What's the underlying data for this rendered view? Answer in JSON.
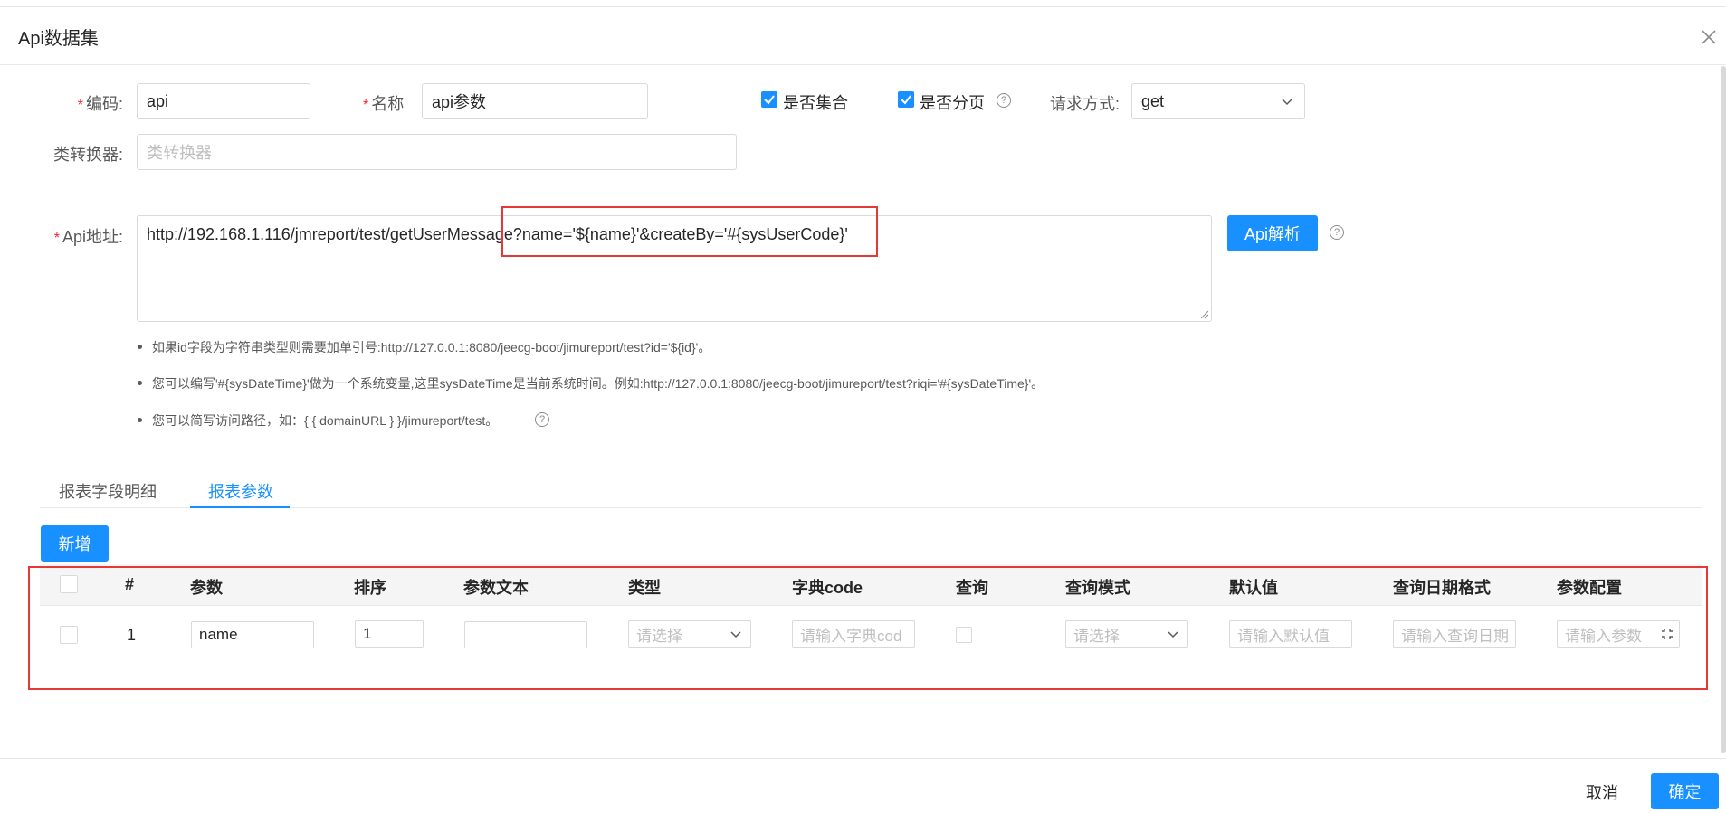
{
  "modal": {
    "title": "Api数据集"
  },
  "form": {
    "code": {
      "label": "编码:",
      "value": "api"
    },
    "name": {
      "label": "名称",
      "value": "api参数"
    },
    "is_collection": {
      "label": "是否集合",
      "checked": true
    },
    "is_paging": {
      "label": "是否分页",
      "checked": true
    },
    "request_method": {
      "label": "请求方式:",
      "value": "get"
    },
    "class_converter": {
      "label": "类转换器:",
      "placeholder": "类转换器"
    },
    "api_url": {
      "label": "Api地址:",
      "value": "http://192.168.1.116/jmreport/test/getUserMessage?name='${name}'&createBy='#{sysUserCode}'"
    },
    "parse_button": "Api解析"
  },
  "tips": [
    "如果id字段为字符串类型则需要加单引号:http://127.0.0.1:8080/jeecg-boot/jimureport/test?id='${id}'。",
    "您可以编写'#{sysDateTime}'做为一个系统变量,这里sysDateTime是当前系统时间。例如:http://127.0.0.1:8080/jeecg-boot/jimureport/test?riqi='#{sysDateTime}'。",
    "您可以简写访问路径，如：{ { domainURL } }/jimureport/test。"
  ],
  "tabs": [
    {
      "label": "报表字段明细",
      "active": false
    },
    {
      "label": "报表参数",
      "active": true
    }
  ],
  "add_button": "新增",
  "table": {
    "headers": [
      "#",
      "参数",
      "排序",
      "参数文本",
      "类型",
      "字典code",
      "查询",
      "查询模式",
      "默认值",
      "查询日期格式",
      "参数配置"
    ],
    "rows": [
      {
        "index": "1",
        "param": "name",
        "order": "1",
        "param_text": "",
        "type_placeholder": "请选择",
        "dict_placeholder": "请输入字典cod",
        "query_mode_placeholder": "请选择",
        "default_placeholder": "请输入默认值",
        "date_format_placeholder": "请输入查询日期",
        "config_placeholder": "请输入参数"
      }
    ]
  },
  "footer": {
    "cancel": "取消",
    "ok": "确定"
  },
  "colors": {
    "primary": "#1890ff",
    "highlight": "#e53935"
  }
}
